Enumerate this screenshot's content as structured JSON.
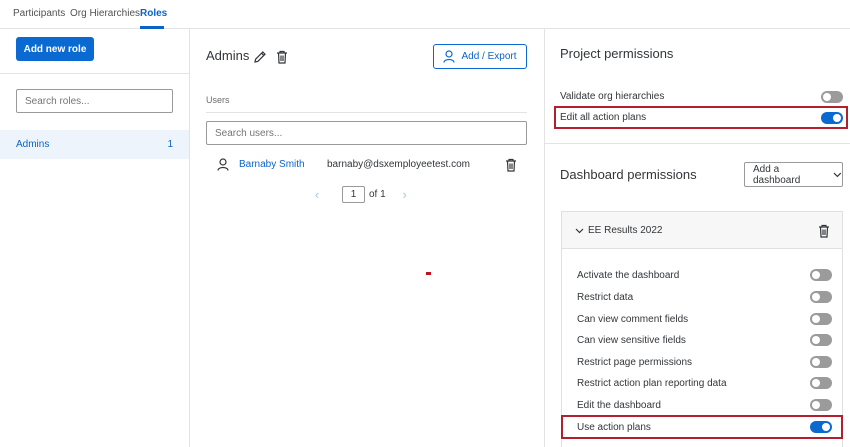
{
  "topnav": {
    "tabs": [
      {
        "label": "Participants"
      },
      {
        "label": "Org Hierarchies"
      },
      {
        "label": "Roles"
      }
    ]
  },
  "left": {
    "add_button": "Add new role",
    "search_placeholder": "Search roles...",
    "roles": [
      {
        "name": "Admins",
        "count": "1"
      }
    ]
  },
  "middle": {
    "title": "Admins",
    "add_export": "Add / Export",
    "users_label": "Users",
    "search_placeholder": "Search users...",
    "users": [
      {
        "name": "Barnaby Smith",
        "email": "barnaby@dsxemployeetest.com"
      }
    ],
    "pagination": {
      "page": "1",
      "of_text": "of 1"
    }
  },
  "right": {
    "project_title": "Project permissions",
    "project_permissions": [
      {
        "label": "Validate org hierarchies",
        "on": false
      },
      {
        "label": "Edit all action plans",
        "on": true
      }
    ],
    "dashboard_title": "Dashboard permissions",
    "add_dashboard": "Add a dashboard",
    "dashboard_name": "EE Results 2022",
    "dashboard_permissions": [
      {
        "label": "Activate the dashboard",
        "on": false
      },
      {
        "label": "Restrict data",
        "on": false
      },
      {
        "label": "Can view comment fields",
        "on": false
      },
      {
        "label": "Can view sensitive fields",
        "on": false
      },
      {
        "label": "Restrict page permissions",
        "on": false
      },
      {
        "label": "Restrict action plan reporting data",
        "on": false
      },
      {
        "label": "Edit the dashboard",
        "on": false
      },
      {
        "label": "Use action plans",
        "on": true
      }
    ]
  },
  "colors": {
    "accent": "#0b6ad1",
    "highlight": "#b21f2d",
    "toggle_off": "#9b9b9b"
  }
}
